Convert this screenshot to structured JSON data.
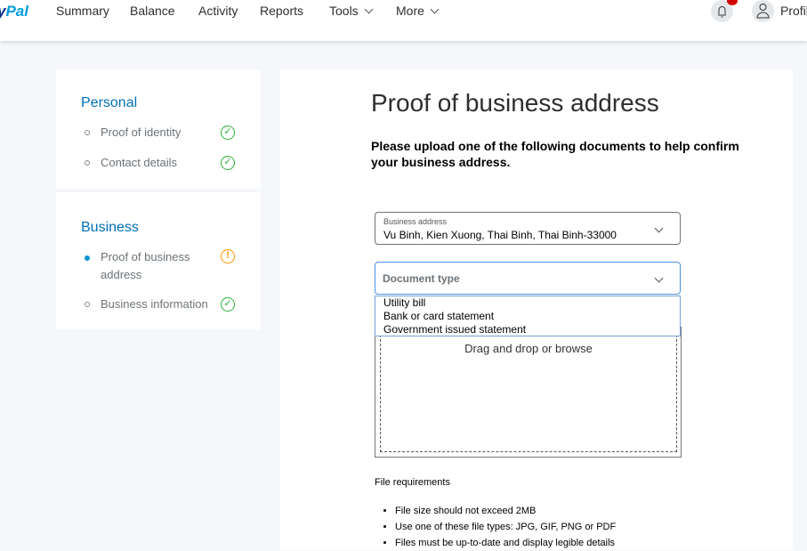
{
  "header": {
    "logo_a": "y",
    "logo_b": "Pal",
    "nav": [
      "Summary",
      "Balance",
      "Activity",
      "Reports",
      "Tools",
      "More"
    ],
    "profile": "Profil"
  },
  "sidebar": {
    "personal": {
      "title": "Personal",
      "items": [
        {
          "label": "Proof of identity",
          "status": "complete"
        },
        {
          "label": "Contact details",
          "status": "complete"
        }
      ]
    },
    "business": {
      "title": "Business",
      "items": [
        {
          "label": "Proof of business address",
          "status": "warning"
        },
        {
          "label": "Business information",
          "status": "complete"
        }
      ]
    }
  },
  "main": {
    "title": "Proof of business address",
    "intro": "Please upload one of the following documents to help confirm your business address.",
    "address_label": "Business address",
    "address_value": "Vu Binh, Kien Xuong, Thai Binh, Thai Binh-33000",
    "doctype_placeholder": "Document type",
    "doctype_options": [
      "Utility bill",
      "Bank or card statement",
      "Government issued statement"
    ],
    "drop_text": "Drag and drop or browse",
    "req_title": "File requirements",
    "reqs": [
      "File size should not exceed 2MB",
      "Use one of these file types: JPG, GIF, PNG or PDF",
      "Files must be up-to-date and display legible details"
    ]
  },
  "colors": {
    "accent": "#0070ba",
    "success": "#2eb33c",
    "warning": "#ff9600"
  }
}
